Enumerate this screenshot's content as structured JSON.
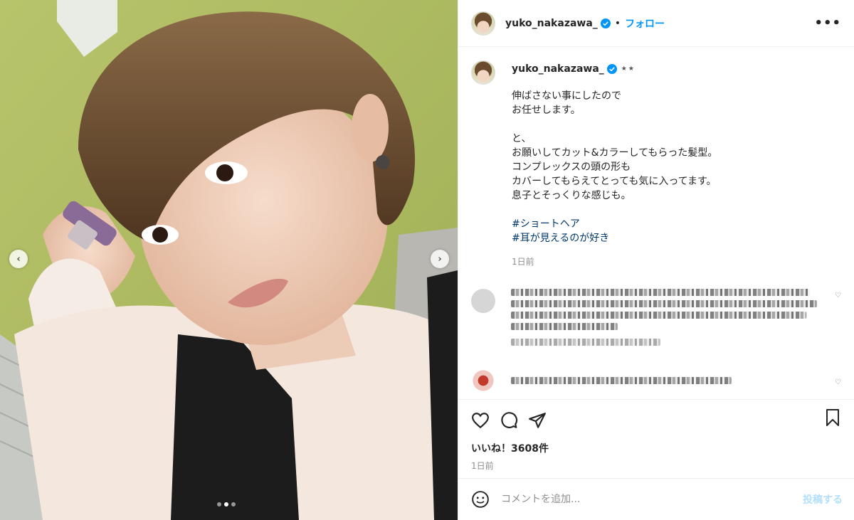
{
  "post": {
    "username": "yuko_nakazawa_",
    "separator": "•",
    "follow_label": "フォロー",
    "more_label": "•••",
    "caption_stars": "★★",
    "caption_text": "伸ばさない事にしたので\nお任せします。\n\nと、\nお願いしてカット&カラーしてもらった髪型。\nコンプレックスの頭の形も\nカバーしてもらえてとっても気に入ってます。\n息子とそっくりな感じも。",
    "hashtags": [
      "#ショートヘア",
      "#耳が見えるのが好き"
    ],
    "caption_time": "1日前",
    "likes": "いいね！3608件",
    "date": "1日前"
  },
  "comment_box": {
    "placeholder": "コメントを追加...",
    "post_label": "投稿する"
  },
  "carousel": {
    "prev_label": "‹",
    "next_label": "›",
    "slide_count": 3,
    "active_index": 1
  },
  "colors": {
    "accent": "#0095f6",
    "wall_green": "#a7b55c",
    "hashtag": "#00376b",
    "muted": "#8e8e8e"
  },
  "icons": {
    "header": "verified-badge-icon",
    "actions": [
      "heart-icon",
      "comment-icon",
      "share-icon",
      "bookmark-icon"
    ],
    "composer": "emoji-icon"
  }
}
